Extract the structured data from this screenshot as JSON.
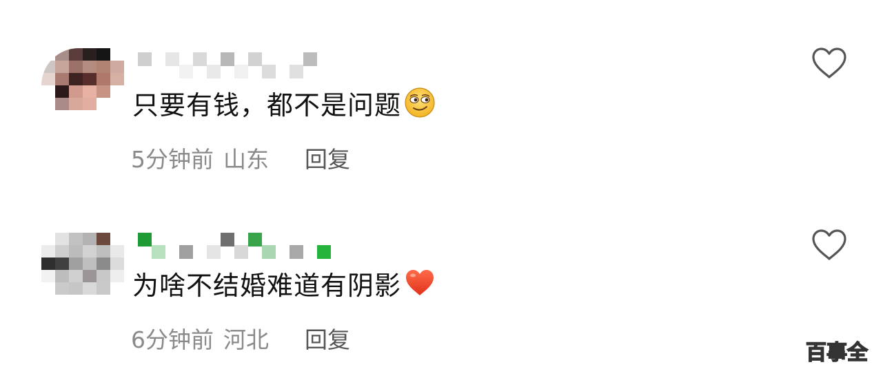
{
  "comments": [
    {
      "text": "只要有钱，都不是问题",
      "emoji": "smirk-face-emoji",
      "time": "5分钟前",
      "location": "山东",
      "reply_label": "回复",
      "avatar_pixels": [
        "#ffffff",
        "#a88e88",
        "#5a3c3a",
        "#2a1f1f",
        "#151515",
        "#ffffff",
        "#cfc6c4",
        "#c7a59a",
        "#9b7168",
        "#b38b7f",
        "#b18373",
        "#cfaaa0",
        "#e6d4d0",
        "#a97a70",
        "#3c2322",
        "#572e2c",
        "#b0786a",
        "#d7b0a4",
        "#ffffff",
        "#2c1819",
        "#d19a8c",
        "#e7b2a3",
        "#c79484",
        "#ffffff",
        "#ffffff",
        "#ab8b89",
        "#d8a89a",
        "#e1aea1",
        "#ffffff",
        "#ffffff",
        "#ffffff",
        "#ffffff",
        "#ffffff",
        "#ffffff",
        "#ffffff",
        "#ffffff"
      ],
      "username_pixels": [
        "#cfcfcf",
        "#ffffff",
        "#e6e6e6",
        "#f2f2f2",
        "#d9d9d9",
        "#e9e9e9",
        "#b8b8b8",
        "#f0f0f0",
        "#d2d2d2",
        "#dcdcdc",
        "#ffffff",
        "#e0e0e0",
        "#bcbcbc",
        "#ffffff"
      ]
    },
    {
      "text": "为啥不结婚难道有阴影",
      "emoji": "red-heart-emoji",
      "time": "6分钟前",
      "location": "河北",
      "reply_label": "回复",
      "avatar_pixels": [
        "#ffffff",
        "#e2e2e2",
        "#c2c2c2",
        "#b3b3b3",
        "#6b4a3d",
        "#ffffff",
        "#ececec",
        "#cfcfcf",
        "#bcbcbc",
        "#d2d2d2",
        "#bfbfbf",
        "#e9e9e9",
        "#2f2f2f",
        "#404040",
        "#a0a0a0",
        "#bfbfbf",
        "#8b8b8b",
        "#dcdcdc",
        "#f2f2f2",
        "#bdbdbd",
        "#d0d0d0",
        "#9b9496",
        "#c8c8c8",
        "#eeeeee",
        "#ffffff",
        "#cacaca",
        "#c6c6c6",
        "#d9d9d9",
        "#c9c9c9",
        "#ffffff",
        "#ffffff",
        "#ffffff",
        "#ffffff",
        "#ffffff",
        "#ffffff",
        "#ffffff"
      ],
      "username_pixels": [
        "#1e9b34",
        "#b8e2bf",
        "#ffffff",
        "#9f9f9f",
        "#ffffff",
        "#e5e5e5",
        "#6f6f6f",
        "#d8d8d8",
        "#3aa44b",
        "#aad7b1",
        "#ffffff",
        "#a8a8a8",
        "#ffffff",
        "#25b33c"
      ]
    }
  ],
  "watermark": "百事全",
  "icons": {
    "like": "heart-outline-icon"
  }
}
